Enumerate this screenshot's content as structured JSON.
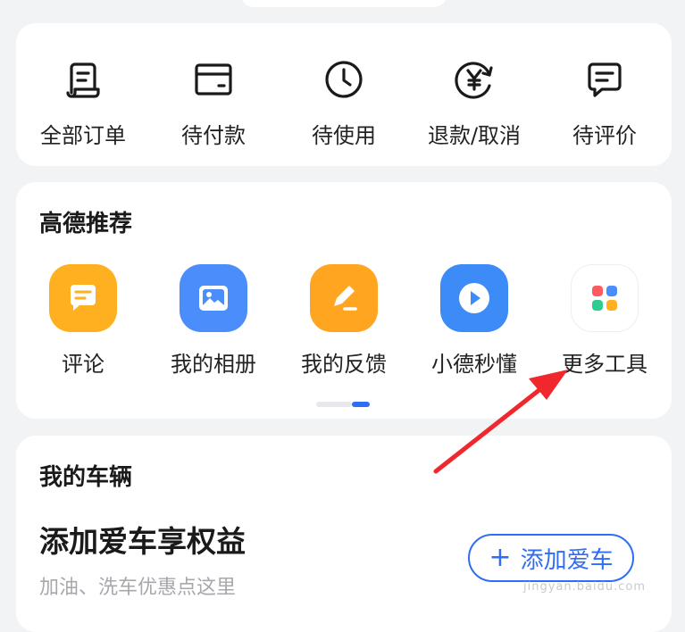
{
  "orders": {
    "items": [
      {
        "label": "全部订单",
        "icon": "receipt-icon"
      },
      {
        "label": "待付款",
        "icon": "wallet-icon"
      },
      {
        "label": "待使用",
        "icon": "clock-icon"
      },
      {
        "label": "退款/取消",
        "icon": "refund-yen-icon"
      },
      {
        "label": "待评价",
        "icon": "comment-icon"
      }
    ]
  },
  "recommend": {
    "title": "高德推荐",
    "items": [
      {
        "label": "评论",
        "icon": "comment-bubble-icon",
        "color": "#ffb020"
      },
      {
        "label": "我的相册",
        "icon": "photo-album-icon",
        "color": "#4a8dfb"
      },
      {
        "label": "我的反馈",
        "icon": "edit-pen-icon",
        "color": "#ffa51f"
      },
      {
        "label": "小德秒懂",
        "icon": "play-icon",
        "color": "#3d8bf7"
      },
      {
        "label": "更多工具",
        "icon": "more-grid-icon",
        "color": "#ffffff"
      }
    ],
    "page_indicator": {
      "pages": 2,
      "active": 2
    }
  },
  "vehicle": {
    "title": "我的车辆",
    "headline": "添加爱车享权益",
    "subtitle": "加油、洗车优惠点这里",
    "button_label": "添加爱车",
    "accent": "#2f6df6"
  },
  "watermark": "jingyan.baidu.com"
}
